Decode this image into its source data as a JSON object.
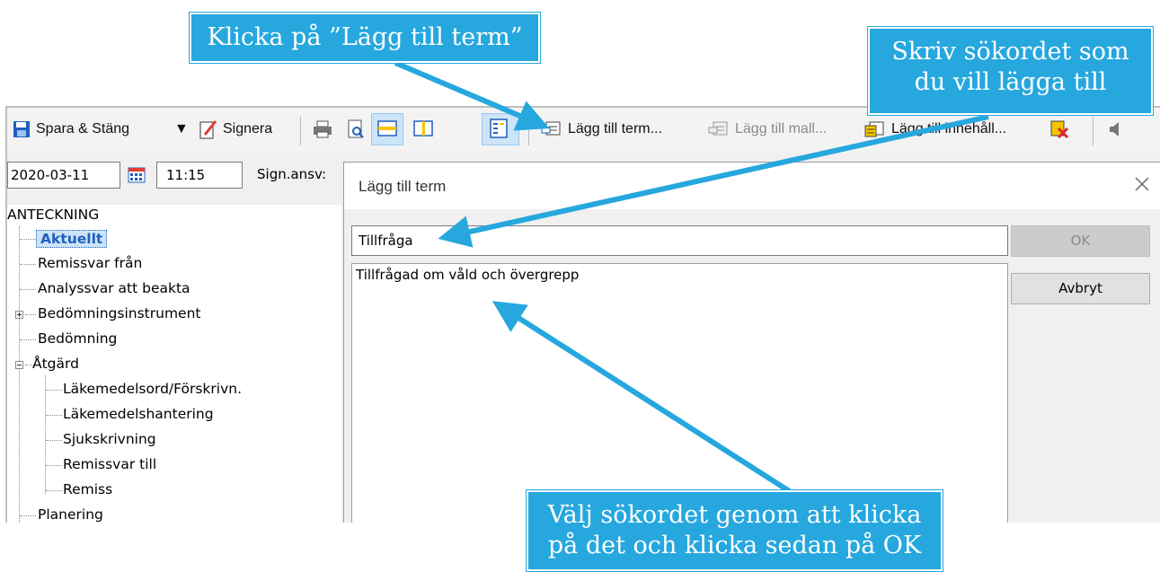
{
  "toolbar": {
    "save_close": "Spara & Stäng",
    "sign": "Signera",
    "add_term": "Lägg till term...",
    "add_template": "Lägg till mall...",
    "add_content": "Lägg till innehåll..."
  },
  "header": {
    "date": "2020-03-11",
    "time": "11:15",
    "sign_resp_label": "Sign.ansv:"
  },
  "tree": {
    "root": "ANTECKNING",
    "items": [
      "Aktuellt",
      "Remissvar från",
      "Analyssvar att beakta",
      "Bedömningsinstrument",
      "Bedömning",
      "Åtgärd",
      "Läkemedelsord/Förskrivn.",
      "Läkemedelshantering",
      "Sjukskrivning",
      "Remissvar till",
      "Remiss",
      "Planering"
    ]
  },
  "dialog": {
    "title": "Lägg till term",
    "search_value": "Tillfråga",
    "results": [
      "Tillfrågad om våld och övergrepp"
    ],
    "ok_label": "OK",
    "cancel_label": "Avbryt"
  },
  "annotations": {
    "top_left": "Klicka på ”Lägg till term”",
    "top_right_line1": "Skriv sökordet som",
    "top_right_line2": "du vill lägga till",
    "bottom_line1": "Välj sökordet genom att klicka",
    "bottom_line2": "på det och klicka sedan på OK"
  },
  "colors": {
    "callout": "#26a7de",
    "arrow": "#26a7de",
    "selection": "#cce4f7"
  }
}
